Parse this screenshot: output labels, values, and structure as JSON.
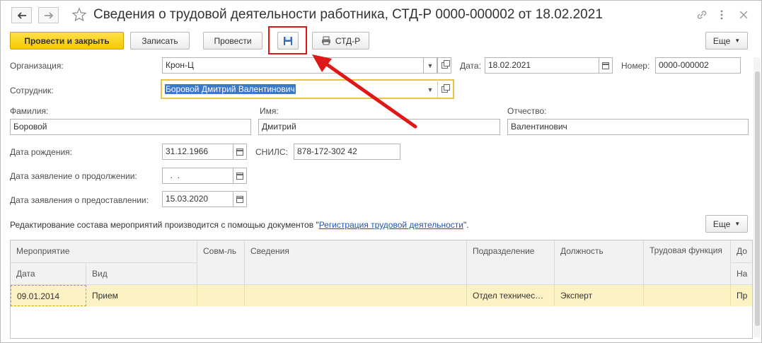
{
  "window": {
    "title": "Сведения о трудовой деятельности работника, СТД-Р 0000-000002 от 18.02.2021"
  },
  "toolbar": {
    "post_close": "Провести и закрыть",
    "write": "Записать",
    "post": "Провести",
    "print_std": "СТД-Р",
    "more": "Еще"
  },
  "form": {
    "organization_label": "Организация:",
    "organization_value": "Крон-Ц",
    "date_label": "Дата:",
    "date_value": "18.02.2021",
    "number_label": "Номер:",
    "number_value": "0000-000002",
    "employee_label": "Сотрудник:",
    "employee_value": "Боровой Дмитрий Валентинович",
    "surname_label": "Фамилия:",
    "surname_value": "Боровой",
    "name_label": "Имя:",
    "name_value": "Дмитрий",
    "patronymic_label": "Отчество:",
    "patronymic_value": "Валентинович",
    "birth_label": "Дата рождения:",
    "birth_value": "31.12.1966",
    "snils_label": "СНИЛС:",
    "snils_value": "878-172-302 42",
    "continue_label": "Дата заявление о продолжении:",
    "continue_value": "  .  .",
    "provide_label": "Дата заявления о предоставлении:",
    "provide_value": "15.03.2020",
    "info_prefix": "Редактирование состава мероприятий производится с помощью документов \"",
    "info_link": "Регистрация трудовой деятельности",
    "info_suffix": "\".",
    "more": "Еще"
  },
  "table": {
    "headers": {
      "event": "Мероприятие",
      "date": "Дата",
      "kind": "Вид",
      "combo": "Совм-ль",
      "info": "Сведения",
      "division": "Подразделение",
      "position": "Должность",
      "function": "Трудовая функция",
      "extra_top": "До",
      "extra_bottom": "На"
    },
    "rows": [
      {
        "date": "09.01.2014",
        "kind": "Прием",
        "combo": "",
        "info": "",
        "division": "Отдел техничес…",
        "position": "Эксперт",
        "function": "",
        "extra": "Пр"
      }
    ]
  },
  "colors": {
    "accent_yellow": "#f5c800",
    "highlight_red": "#e01717",
    "selected_row": "#fdf2c4",
    "link_blue": "#1f56b3"
  }
}
